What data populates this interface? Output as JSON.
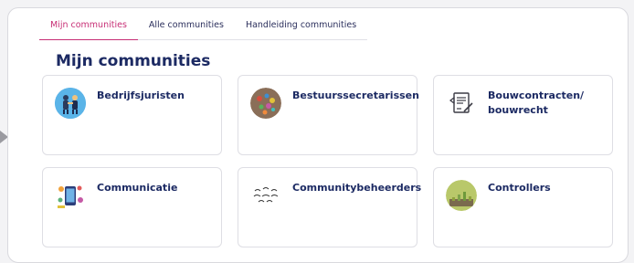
{
  "tabs": [
    {
      "label": "Mijn communities"
    },
    {
      "label": "Alle communities"
    },
    {
      "label": "Handleiding communities"
    }
  ],
  "page_title": "Mijn communities",
  "cards": [
    {
      "label": "Bedrijfsjuristen",
      "icon": "business-people-icon"
    },
    {
      "label": "Bestuurssecretarissen",
      "icon": "colored-pins-icon"
    },
    {
      "label": "Bouwcontracten/ bouwrecht",
      "icon": "contract-document-icon"
    },
    {
      "label": "Communicatie",
      "icon": "phone-communication-icon"
    },
    {
      "label": "Communitybeheerders",
      "icon": "word-cloud-icon"
    },
    {
      "label": "Controllers",
      "icon": "plant-growth-icon"
    }
  ],
  "colors": {
    "accent": "#c72e75",
    "title": "#1c2a63",
    "border": "#dedee4"
  }
}
